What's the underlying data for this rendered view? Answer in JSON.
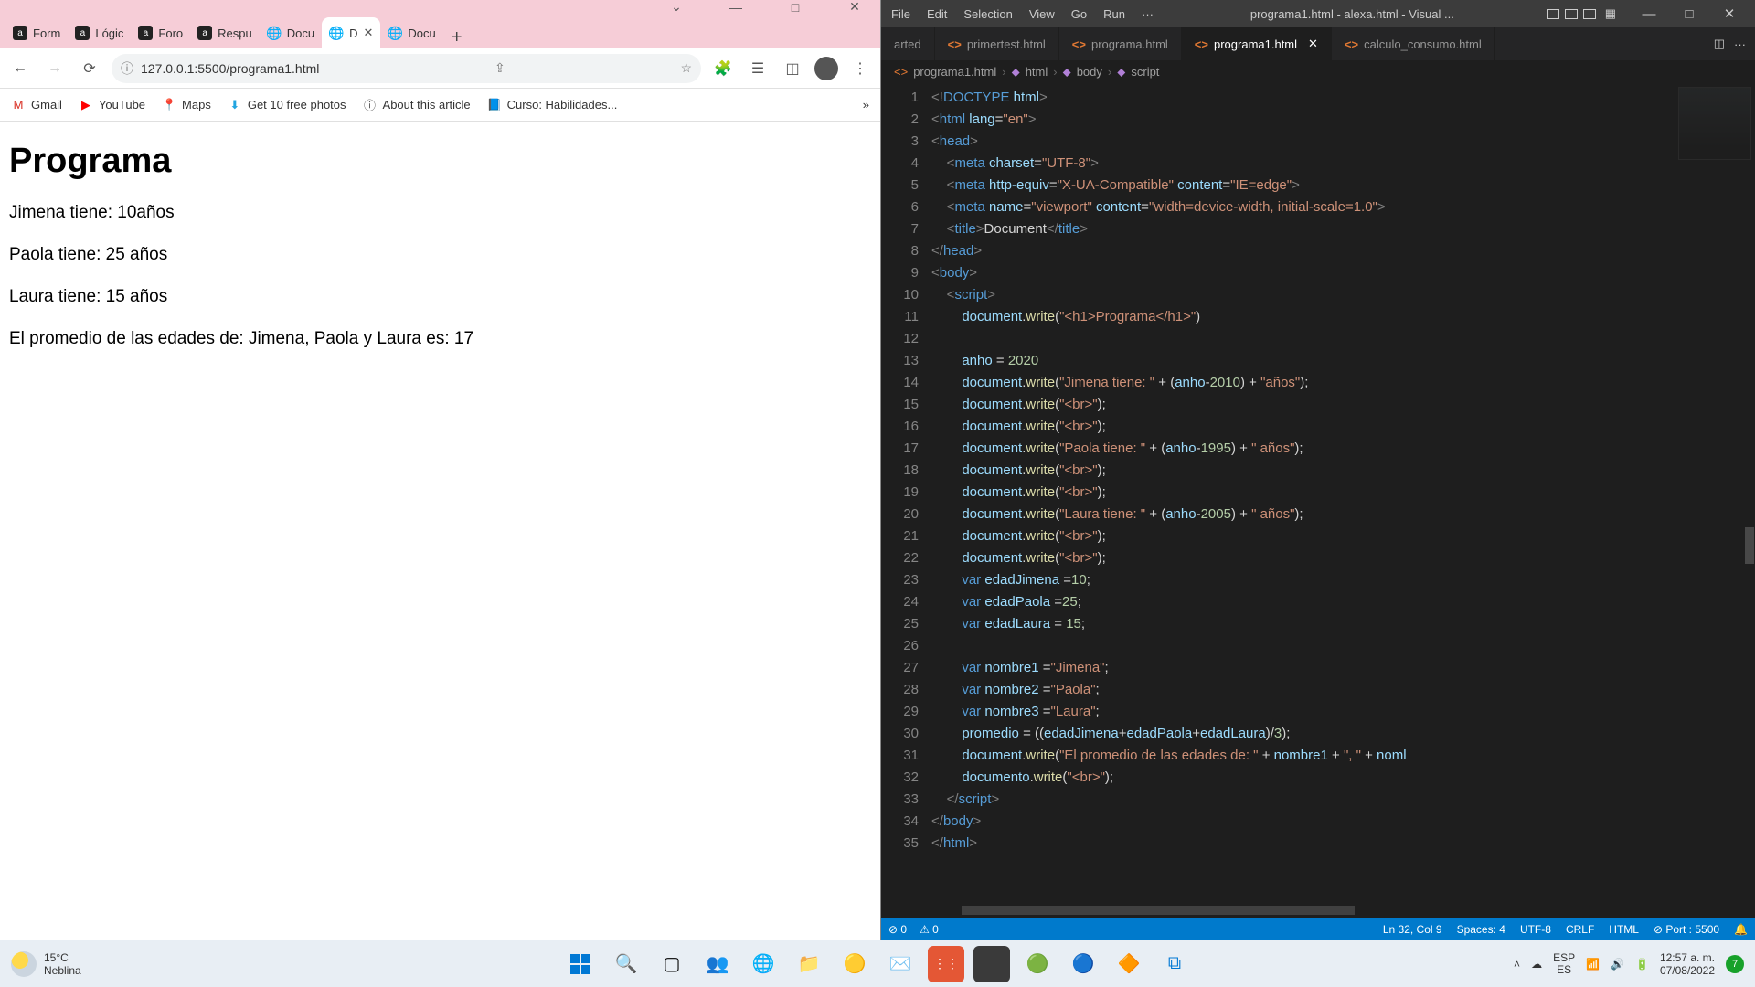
{
  "browser": {
    "tabs": [
      {
        "label": "Form",
        "fav": "a"
      },
      {
        "label": "Lógic",
        "fav": "a"
      },
      {
        "label": "Foro",
        "fav": "a"
      },
      {
        "label": "Respu",
        "fav": "a"
      },
      {
        "label": "Docu",
        "fav": "globe"
      },
      {
        "label": "D",
        "fav": "globe",
        "active": true
      },
      {
        "label": "Docu",
        "fav": "globe"
      }
    ],
    "url": "127.0.0.1:5500/programa1.html",
    "bookmarks": [
      {
        "icon": "M",
        "label": "Gmail",
        "color": "#d93025"
      },
      {
        "icon": "▶",
        "label": "YouTube",
        "color": "#ff0000"
      },
      {
        "icon": "📍",
        "label": "Maps",
        "color": "#34a853"
      },
      {
        "icon": "⬇",
        "label": "Get 10 free photos",
        "color": "#22a5e0"
      },
      {
        "icon": "ⓘ",
        "label": "About this article",
        "color": "#555"
      },
      {
        "icon": "📘",
        "label": "Curso: Habilidades...",
        "color": "#2f6fb0"
      }
    ],
    "page": {
      "title": "Programa",
      "lines": [
        "Jimena tiene: 10años",
        "Paola tiene: 25 años",
        "Laura tiene: 15 años",
        "El promedio de las edades de: Jimena, Paola y Laura es: 17"
      ]
    }
  },
  "vscode": {
    "menus": [
      "File",
      "Edit",
      "Selection",
      "View",
      "Go",
      "Run",
      "···"
    ],
    "title": "programa1.html - alexa.html - Visual ...",
    "tabs": [
      {
        "label": "arted"
      },
      {
        "label": "primertest.html"
      },
      {
        "label": "programa.html"
      },
      {
        "label": "programa1.html",
        "active": true
      },
      {
        "label": "calculo_consumo.html"
      }
    ],
    "breadcrumb": [
      "programa1.html",
      "html",
      "body",
      "script"
    ],
    "status": {
      "errors": "⊘ 0",
      "warnings": "⚠ 0",
      "lncol": "Ln 32, Col 9",
      "spaces": "Spaces: 4",
      "enc": "UTF-8",
      "eol": "CRLF",
      "lang": "HTML",
      "port": "⊘ Port : 5500",
      "bell": "🔔"
    }
  },
  "taskbar": {
    "temp": "15°C",
    "cond": "Neblina",
    "lang1": "ESP",
    "lang2": "ES",
    "time": "12:57 a. m.",
    "date": "07/08/2022",
    "notif": "7"
  }
}
